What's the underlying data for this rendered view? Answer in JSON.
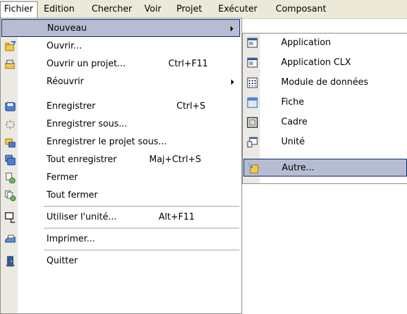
{
  "menubar": {
    "items": [
      "Fichier",
      "Edition",
      "Chercher",
      "Voir",
      "Projet",
      "Exécuter",
      "Composant"
    ]
  },
  "file_menu": {
    "items": [
      {
        "label": "Nouveau",
        "shortcut": "",
        "submenu": true,
        "icon": "none",
        "highlighted": true
      },
      {
        "label": "Ouvrir...",
        "shortcut": "",
        "icon": "open-folder-icon"
      },
      {
        "label": "Ouvrir un projet...",
        "shortcut": "Ctrl+F11",
        "icon": "open-project-icon"
      },
      {
        "label": "Réouvrir",
        "shortcut": "",
        "submenu": true,
        "icon": "none"
      },
      {
        "label": "Enregistrer",
        "shortcut": "Ctrl+S",
        "icon": "save-disk-icon"
      },
      {
        "label": "Enregistrer sous...",
        "shortcut": "",
        "icon": "save-as-icon"
      },
      {
        "label": "Enregistrer le projet sous...",
        "shortcut": "",
        "icon": "save-project-icon"
      },
      {
        "label": "Tout enregistrer",
        "shortcut": "Maj+Ctrl+S",
        "icon": "save-all-icon"
      },
      {
        "label": "Fermer",
        "shortcut": "",
        "icon": "close-file-icon"
      },
      {
        "label": "Tout fermer",
        "shortcut": "",
        "icon": "close-all-icon"
      },
      {
        "label": "Utiliser l'unité...",
        "shortcut": "Alt+F11",
        "icon": "use-unit-icon"
      },
      {
        "label": "Imprimer...",
        "shortcut": "",
        "icon": "printer-icon"
      },
      {
        "label": "Quitter",
        "shortcut": "",
        "icon": "exit-door-icon"
      }
    ]
  },
  "new_submenu": {
    "items": [
      {
        "label": "Application",
        "icon": "application-window-icon"
      },
      {
        "label": "Application CLX",
        "icon": "clx-application-icon"
      },
      {
        "label": "Module de données",
        "icon": "data-module-icon"
      },
      {
        "label": "Fiche",
        "icon": "form-icon"
      },
      {
        "label": "Cadre",
        "icon": "frame-icon"
      },
      {
        "label": "Unité",
        "icon": "unit-icon"
      },
      {
        "label": "Autre...",
        "icon": "other-wizard-icon",
        "highlighted": true
      }
    ]
  },
  "colors": {
    "menubar_bg": "#ece9d8",
    "gutter_bg": "#ebe9e2",
    "highlight_bg": "#b6bdd2",
    "highlight_border": "#0a246a"
  }
}
